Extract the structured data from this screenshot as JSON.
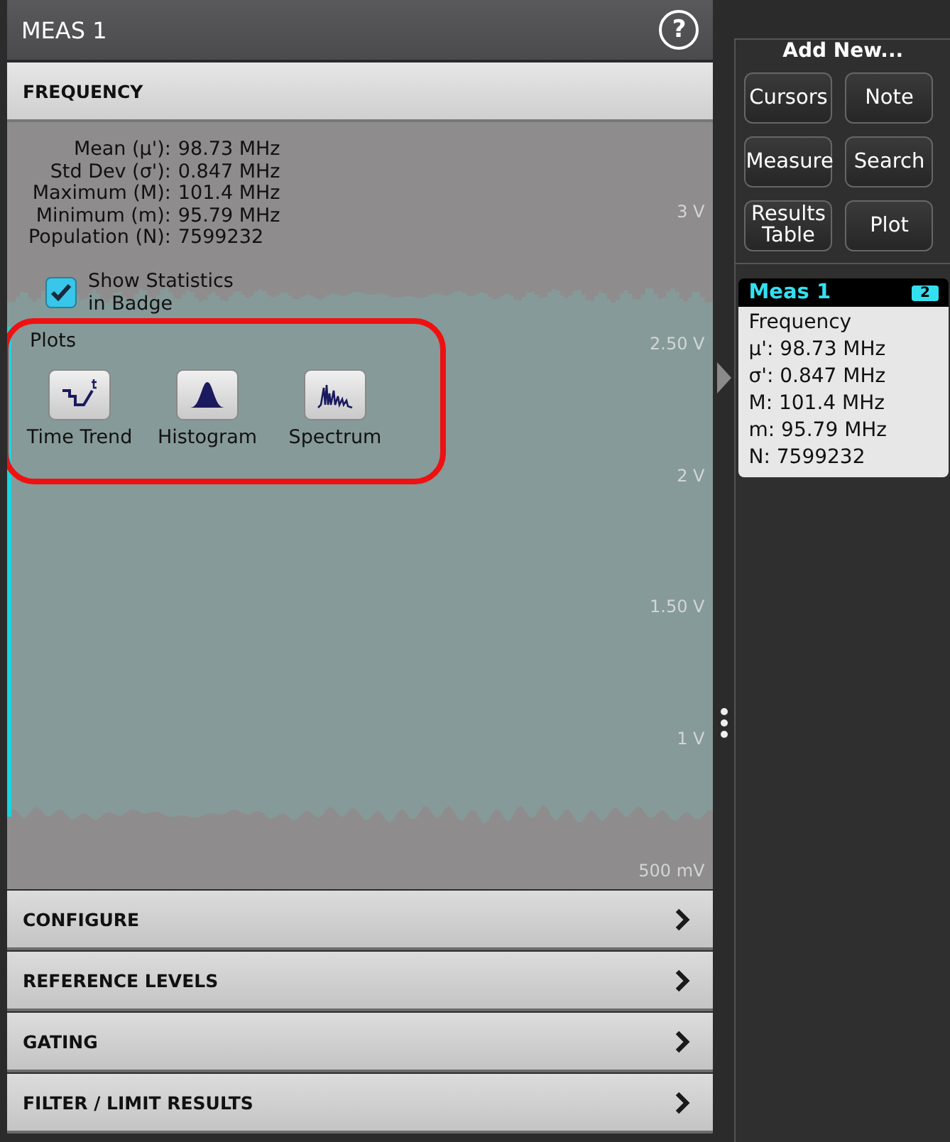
{
  "panel": {
    "title": "MEAS 1",
    "help": "?",
    "header": "FREQUENCY",
    "statistics": [
      {
        "label": "Mean (µ'):",
        "value": "98.73 MHz"
      },
      {
        "label": "Std Dev (σ'):",
        "value": "0.847 MHz"
      },
      {
        "label": "Maximum (M):",
        "value": "101.4 MHz"
      },
      {
        "label": "Minimum (m):",
        "value": "95.79 MHz"
      },
      {
        "label": "Population (N):",
        "value": "7599232"
      }
    ],
    "show_statistics": {
      "label": "Show Statistics in Badge",
      "checked": true
    },
    "plots": {
      "title": "Plots",
      "items": [
        {
          "label": "Time Trend",
          "kind": "trend"
        },
        {
          "label": "Histogram",
          "kind": "histogram"
        },
        {
          "label": "Spectrum",
          "kind": "spectrum"
        }
      ]
    },
    "axis_labels": [
      "3 V",
      "2.50 V",
      "2 V",
      "1.50 V",
      "1 V",
      "500 mV"
    ],
    "sections": [
      {
        "label": "CONFIGURE"
      },
      {
        "label": "REFERENCE LEVELS"
      },
      {
        "label": "GATING"
      },
      {
        "label": "FILTER / LIMIT RESULTS"
      }
    ]
  },
  "add_new": {
    "title": "Add New...",
    "buttons": [
      "Cursors",
      "Note",
      "Measure",
      "Search",
      "Results Table",
      "Plot"
    ]
  },
  "badge": {
    "title": "Meas 1",
    "tag": "2",
    "lines": [
      "Frequency",
      "µ': 98.73 MHz",
      "σ': 0.847 MHz",
      "M: 101.4 MHz",
      "m: 95.79 MHz",
      "N: 7599232"
    ]
  }
}
